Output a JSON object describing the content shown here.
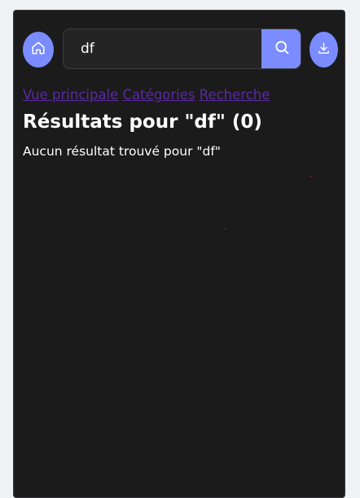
{
  "search": {
    "value": "df"
  },
  "icons": {
    "home": "home-icon",
    "search": "search-icon",
    "download": "download-icon"
  },
  "colors": {
    "accent": "#7a8cff",
    "panel_background": "#1b1b1c",
    "page_background": "#f0f1f4",
    "link": "#5b2aa0"
  },
  "nav": {
    "main_view": "Vue principale",
    "categories": "Catégories",
    "search": "Recherche"
  },
  "results": {
    "title": "Résultats pour \"df\" (0)",
    "empty_message": "Aucun résultat trouvé pour \"df\""
  }
}
